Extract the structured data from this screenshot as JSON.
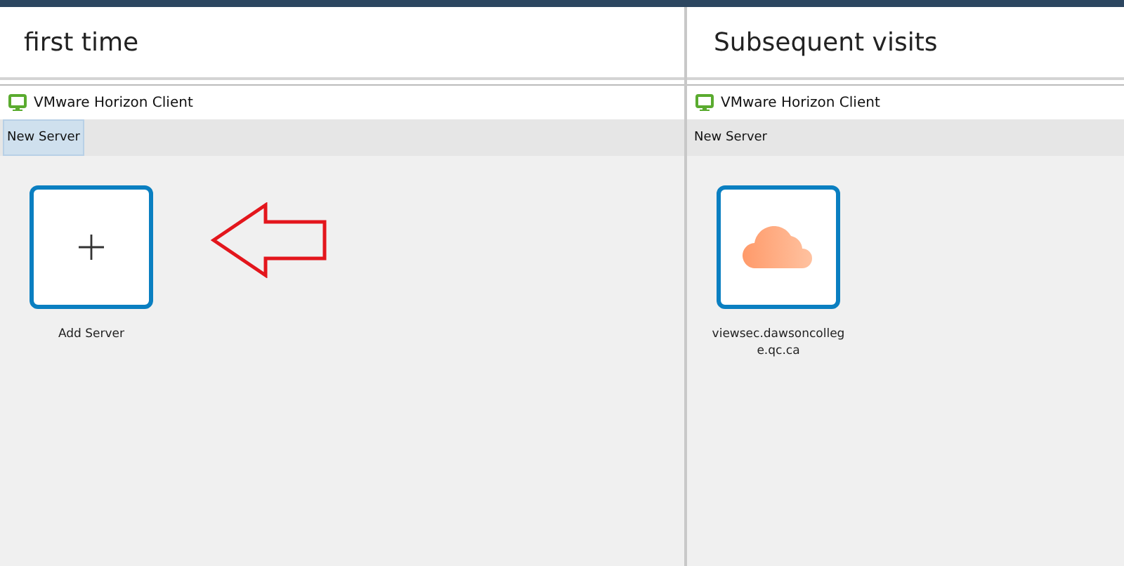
{
  "panels": [
    {
      "heading": "first time",
      "window": {
        "title": "VMware Horizon Client",
        "toolbar": [
          {
            "label": "New Server",
            "selected": true
          }
        ],
        "tiles": [
          {
            "kind": "add",
            "label": "Add Server"
          }
        ]
      },
      "arrow": true
    },
    {
      "heading": "Subsequent visits",
      "window": {
        "title": "VMware Horizon Client",
        "toolbar": [
          {
            "label": "New Server",
            "selected": false
          }
        ],
        "tiles": [
          {
            "kind": "server",
            "label": "viewsec.dawsoncollege.qc.ca"
          }
        ]
      },
      "arrow": false
    }
  ]
}
